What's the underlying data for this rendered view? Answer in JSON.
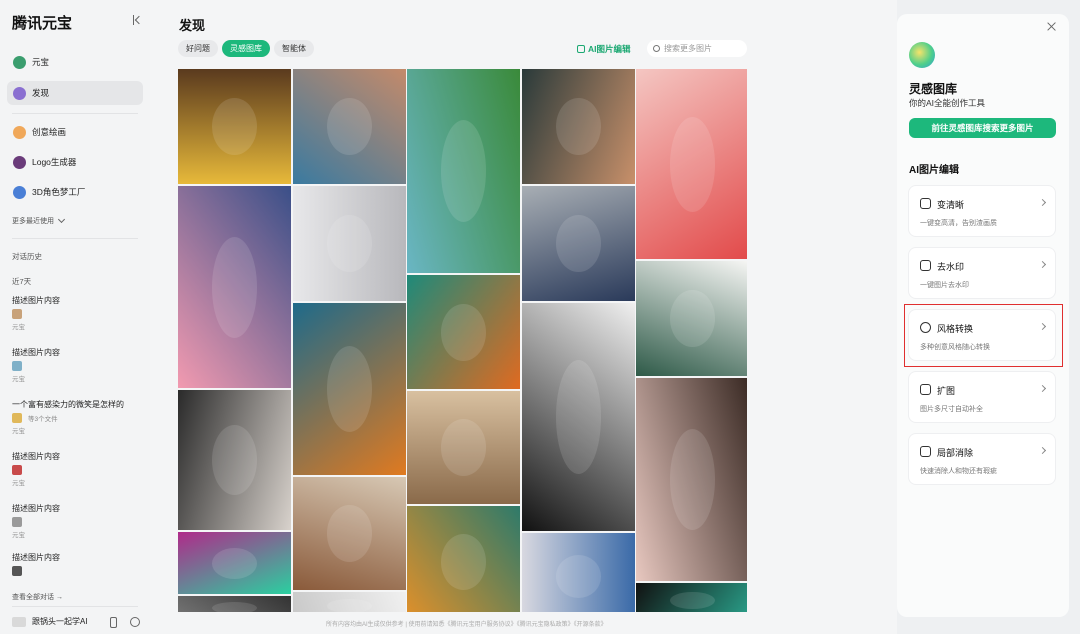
{
  "sidebar": {
    "brand": "腾讯元宝",
    "nav": [
      {
        "label": "元宝",
        "icon": "yuanbao-icon",
        "color": "#3a9d6e",
        "active": false
      },
      {
        "label": "发现",
        "icon": "discover-icon",
        "color": "#8a6fd1",
        "active": true
      },
      {
        "label": "创意绘画",
        "icon": "painting-icon",
        "color": "#f0a85a",
        "active": false
      },
      {
        "label": "Logo生成器",
        "icon": "logo-generator-icon",
        "color": "#6a3b7a",
        "active": false
      },
      {
        "label": "3D角色梦工厂",
        "icon": "3d-character-icon",
        "color": "#4a7fd6",
        "active": false
      }
    ],
    "more_recent": "更多最近使用",
    "history_heading": "对话历史",
    "recent_label": "近7天",
    "history": [
      {
        "title": "描述图片内容",
        "source": "元宝",
        "files": "",
        "thumb": "#c8a27a"
      },
      {
        "title": "描述图片内容",
        "source": "元宝",
        "files": "",
        "thumb": "#7fb0c8"
      },
      {
        "title": "一个富有感染力的微笑是怎样的",
        "source": "元宝",
        "files": "等3个文件",
        "thumb": "#e0b85a"
      },
      {
        "title": "描述图片内容",
        "source": "元宝",
        "files": "",
        "thumb": "#c84a4a"
      },
      {
        "title": "描述图片内容",
        "source": "元宝",
        "files": "",
        "thumb": "#9a9a9a"
      },
      {
        "title": "描述图片内容",
        "source": "元宝",
        "files": "",
        "thumb": "#555555"
      }
    ],
    "all_history": "查看全部对话 →",
    "user_name": "跟锅头一起学AI"
  },
  "main": {
    "title": "发现",
    "tabs": [
      {
        "label": "好问题",
        "active": false
      },
      {
        "label": "灵感图库",
        "active": true
      },
      {
        "label": "智能体",
        "active": false
      }
    ],
    "ai_edit": "AI图片编辑",
    "search_placeholder": "搜索更多图片",
    "footer": "所有内容均由AI生成仅供参考 | 使用前请知悉《腾讯元宝用户服务协议》《腾讯元宝隐私政策》《开源条款》"
  },
  "gallery": [
    [
      {
        "h": 115,
        "c1": "#e7b93a",
        "c2": "#5a3a1e",
        "subject": "cow and cat"
      },
      {
        "h": 202,
        "c1": "#f29ab0",
        "c2": "#3a4f88",
        "subject": "pixel clouds night"
      },
      {
        "h": 140,
        "c1": "#2a2a2a",
        "c2": "#d8d2cc",
        "subject": "woman portrait bw"
      },
      {
        "h": 62,
        "c1": "#b02a8a",
        "c2": "#2ad0a0",
        "subject": "planet aurora"
      },
      {
        "h": 24,
        "c1": "#333333",
        "c2": "#777777",
        "subject": "partial"
      }
    ],
    [
      {
        "h": 115,
        "c1": "#3a7aa0",
        "c2": "#c48a6a",
        "subject": "woman in water"
      },
      {
        "h": 115,
        "c1": "#e8e8ea",
        "c2": "#b8b8bc",
        "subject": "white cat"
      },
      {
        "h": 172,
        "c1": "#1e6a8a",
        "c2": "#e07a20",
        "subject": "water and fire swirl"
      },
      {
        "h": 113,
        "c1": "#d7c8b4",
        "c2": "#8a5a3a",
        "subject": "horned sculpture"
      },
      {
        "h": 28,
        "c1": "#f0f0f0",
        "c2": "#c8c8c8",
        "subject": "partial"
      }
    ],
    [
      {
        "h": 204,
        "c1": "#6ab6c4",
        "c2": "#3a8a3a",
        "subject": "island landscape"
      },
      {
        "h": 114,
        "c1": "#1e8a7a",
        "c2": "#e06a20",
        "subject": "abstract waves"
      },
      {
        "h": 113,
        "c1": "#d8c0a0",
        "c2": "#8a6a4a",
        "subject": "kitten in hood"
      },
      {
        "h": 112,
        "c1": "#2e7a6a",
        "c2": "#e0902a",
        "subject": "koi fish"
      }
    ],
    [
      {
        "h": 115,
        "c1": "#2a3a3a",
        "c2": "#c8906a",
        "subject": "woman portrait"
      },
      {
        "h": 115,
        "c1": "#a8aeb4",
        "c2": "#2a3a5a",
        "subject": "masked figure"
      },
      {
        "h": 228,
        "c1": "#f0f0f0",
        "c2": "#111111",
        "subject": "laughing man bw"
      },
      {
        "h": 86,
        "c1": "#3a6aa8",
        "c2": "#d8d8e0",
        "subject": "robot"
      }
    ],
    [
      {
        "h": 190,
        "c1": "#f4c6c2",
        "c2": "#e24a4a",
        "subject": "dog with heart"
      },
      {
        "h": 115,
        "c1": "#f6f6f4",
        "c2": "#2e5a48",
        "subject": "bearded man line art"
      },
      {
        "h": 203,
        "c1": "#3a2a24",
        "c2": "#e8c8c0",
        "subject": "woman with flowers"
      },
      {
        "h": 35,
        "c1": "#2aa08a",
        "c2": "#111111",
        "subject": "partial"
      }
    ]
  ],
  "panel": {
    "title": "灵感图库",
    "subtitle": "你的AI全能创作工具",
    "go_button": "前往灵感图库搜索更多图片",
    "section_title": "AI图片编辑",
    "cards": [
      {
        "title": "变清晰",
        "desc": "一键变高清，告别渣画质",
        "icon": "hd-icon"
      },
      {
        "title": "去水印",
        "desc": "一键图片去水印",
        "icon": "eraser-icon"
      },
      {
        "title": "风格转换",
        "desc": "多种创意风格随心转换",
        "icon": "style-transfer-icon"
      },
      {
        "title": "扩图",
        "desc": "图片多尺寸自动补全",
        "icon": "expand-icon"
      },
      {
        "title": "局部消除",
        "desc": "快速消除人和物还有瑕疵",
        "icon": "partial-erase-icon"
      }
    ]
  },
  "colors": {
    "accent": "#1db87c",
    "highlight": "#e02f2f"
  }
}
